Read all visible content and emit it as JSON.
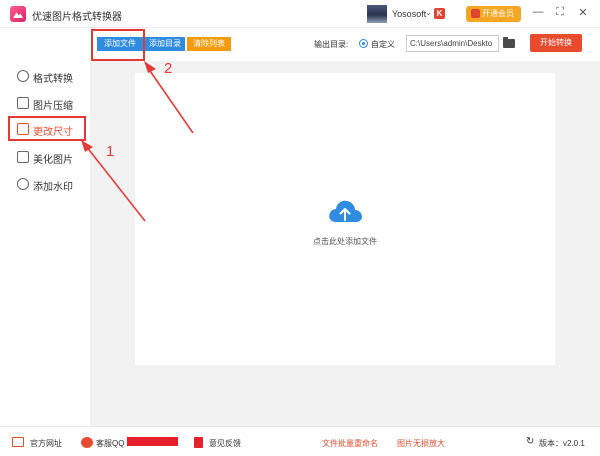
{
  "titlebar": {
    "app_title": "优速图片格式转换器",
    "username": "Yososoft",
    "user_caret": "⌄",
    "logout_glyph": "K",
    "vip_label": "开通会员",
    "minimize": "—",
    "maximize": "⛶",
    "close": "✕"
  },
  "toolbar": {
    "add_file": "添加文件",
    "add_dir": "添加目录",
    "clear_list": "清除列表",
    "output_label": "输出目录:",
    "custom_label": "自定义",
    "output_path": "C:\\Users\\admin\\Deskto",
    "start_label": "开始转换"
  },
  "sidebar": {
    "items": [
      {
        "label": "格式转换",
        "icon": "refresh-icon"
      },
      {
        "label": "图片压缩",
        "icon": "compress-icon"
      },
      {
        "label": "更改尺寸",
        "icon": "resize-icon"
      },
      {
        "label": "美化图片",
        "icon": "beautify-icon"
      },
      {
        "label": "添加水印",
        "icon": "watermark-icon"
      }
    ],
    "active_index": 2
  },
  "main": {
    "drop_hint": "点击此处添加文件",
    "icon": "cloud-upload-icon"
  },
  "annotations": {
    "step1": "1",
    "step2": "2",
    "color": "#e53935"
  },
  "footer": {
    "website": "官方网址",
    "support_qq": "客服QQ",
    "feedback": "意见反馈",
    "batch_rename": "文件批量重命名",
    "lossless_zoom": "图片无损放大",
    "version": "版本：v2.0.1"
  },
  "colors": {
    "accent_blue": "#2f8ce0",
    "accent_orange": "#f39c12",
    "start_red": "#e84c2f"
  }
}
